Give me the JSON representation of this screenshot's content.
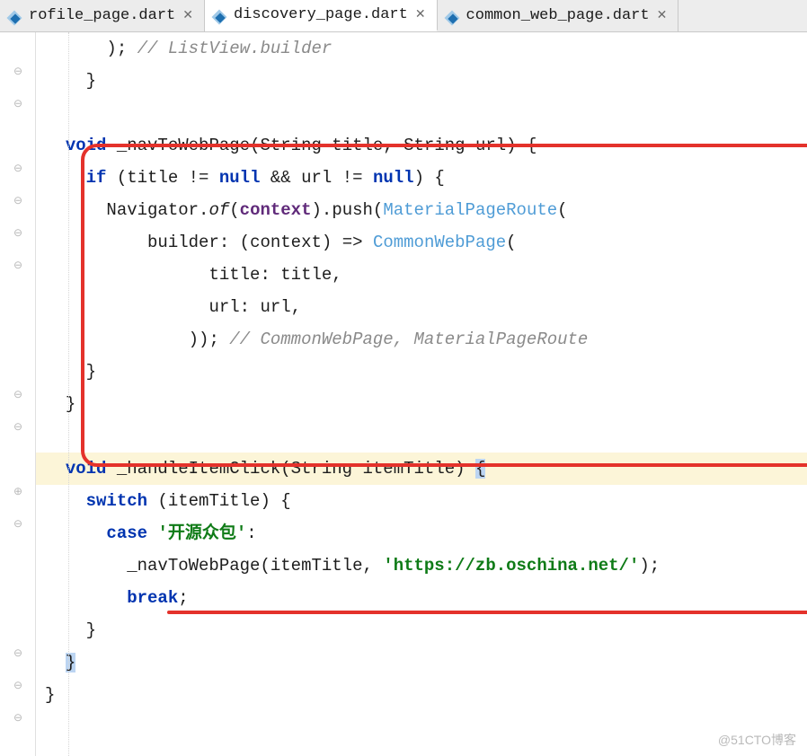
{
  "tabs": [
    {
      "label": "rofile_page.dart",
      "active": false
    },
    {
      "label": "discovery_page.dart",
      "active": true
    },
    {
      "label": "common_web_page.dart",
      "active": false
    }
  ],
  "code": {
    "l1_comment": "// ListView.builder",
    "kw_void": "void",
    "kw_if": "if",
    "kw_null": "null",
    "kw_switch": "switch",
    "kw_case": "case",
    "kw_break": "break",
    "fn_nav": "_navToWebPage",
    "fn_handle": "_handleItemClick",
    "ty_string": "String",
    "ty_mpr": "MaterialPageRoute",
    "ty_cwp": "CommonWebPage",
    "id_title": "title",
    "id_url": "url",
    "id_itemTitle": "itemTitle",
    "id_context": "context",
    "id_Navigator": "Navigator",
    "id_of": "of",
    "id_push": "push",
    "id_builder": "builder",
    "cm_cwp": "// CommonWebPage, MaterialPageRoute",
    "str_case": "'开源众包'",
    "str_url": "'https://zb.oschina.net/'",
    "close_paren_semi": ");",
    "close_brace": "}",
    "open_brace": "{",
    "colon": ":",
    "comma": ",",
    "arrow": "=>",
    "and": "&&",
    "neq": "!=",
    "dot": ".",
    "open_paren": "(",
    "close_paren": ")",
    "triple_close": "));",
    "semi": ";"
  },
  "watermark": "@51CTO博客"
}
